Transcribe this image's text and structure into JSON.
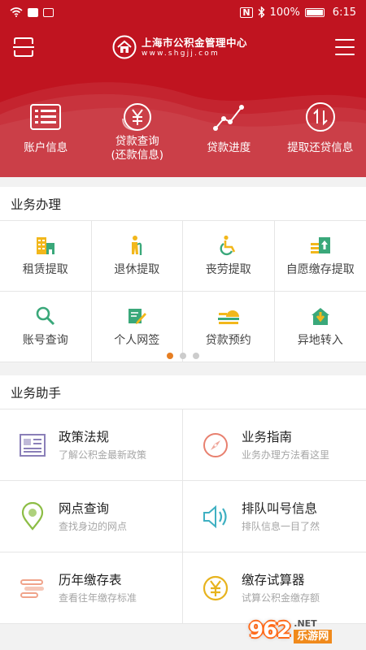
{
  "status_bar": {
    "battery": "100%",
    "time": "6:15",
    "icons": [
      "wifi-icon",
      "notification-icon",
      "mail-icon",
      "nfc-icon",
      "bluetooth-icon",
      "battery-icon"
    ]
  },
  "header": {
    "logo_cn": "上海市公积金管理中心",
    "logo_en": "www.shgjj.com",
    "icons": [
      "scan-icon",
      "menu-icon"
    ],
    "brand_color": "#c01420"
  },
  "quick_actions": [
    {
      "label": "账户信息",
      "icon": "account-list-icon"
    },
    {
      "label": "贷款查询\n(还款信息)",
      "icon": "yuan-circle-icon"
    },
    {
      "label": "贷款进度",
      "icon": "progress-chart-icon"
    },
    {
      "label": "提取还贷信息",
      "icon": "transfer-arrows-icon"
    }
  ],
  "business": {
    "title": "业务办理",
    "items": [
      {
        "label": "租赁提取",
        "icon": "building-icon"
      },
      {
        "label": "退休提取",
        "icon": "elder-person-icon"
      },
      {
        "label": "丧劳提取",
        "icon": "wheelchair-icon"
      },
      {
        "label": "自愿缴存提取",
        "icon": "upload-box-icon"
      },
      {
        "label": "账号查询",
        "icon": "magnifier-icon"
      },
      {
        "label": "个人网签",
        "icon": "sign-pen-icon"
      },
      {
        "label": "贷款预约",
        "icon": "coins-bell-icon"
      },
      {
        "label": "异地转入",
        "icon": "house-transfer-icon"
      }
    ],
    "page_count": 3,
    "active_page": 1,
    "dot_active_color": "#e67e22"
  },
  "helper": {
    "title": "业务助手",
    "items": [
      {
        "title": "政策法规",
        "subtitle": "了解公积金最新政策",
        "icon": "newspaper-icon",
        "color": "#8a7fb8"
      },
      {
        "title": "业务指南",
        "subtitle": "业务办理方法看这里",
        "icon": "compass-icon",
        "color": "#e8806f"
      },
      {
        "title": "网点查询",
        "subtitle": "查找身边的网点",
        "icon": "map-pin-icon",
        "color": "#8cbd45"
      },
      {
        "title": "排队叫号信息",
        "subtitle": "排队信息一目了然",
        "icon": "speaker-icon",
        "color": "#3fb0c2"
      },
      {
        "title": "历年缴存表",
        "subtitle": "查看往年缴存标准",
        "icon": "list-bars-icon",
        "color": "#f0a38a"
      },
      {
        "title": "缴存试算器",
        "subtitle": "试算公积金缴存额",
        "icon": "yuan-calc-icon",
        "color": "#e7b31e"
      }
    ]
  },
  "watermark": {
    "number": "962",
    "domain": ".NET",
    "cn": "乐游网"
  }
}
